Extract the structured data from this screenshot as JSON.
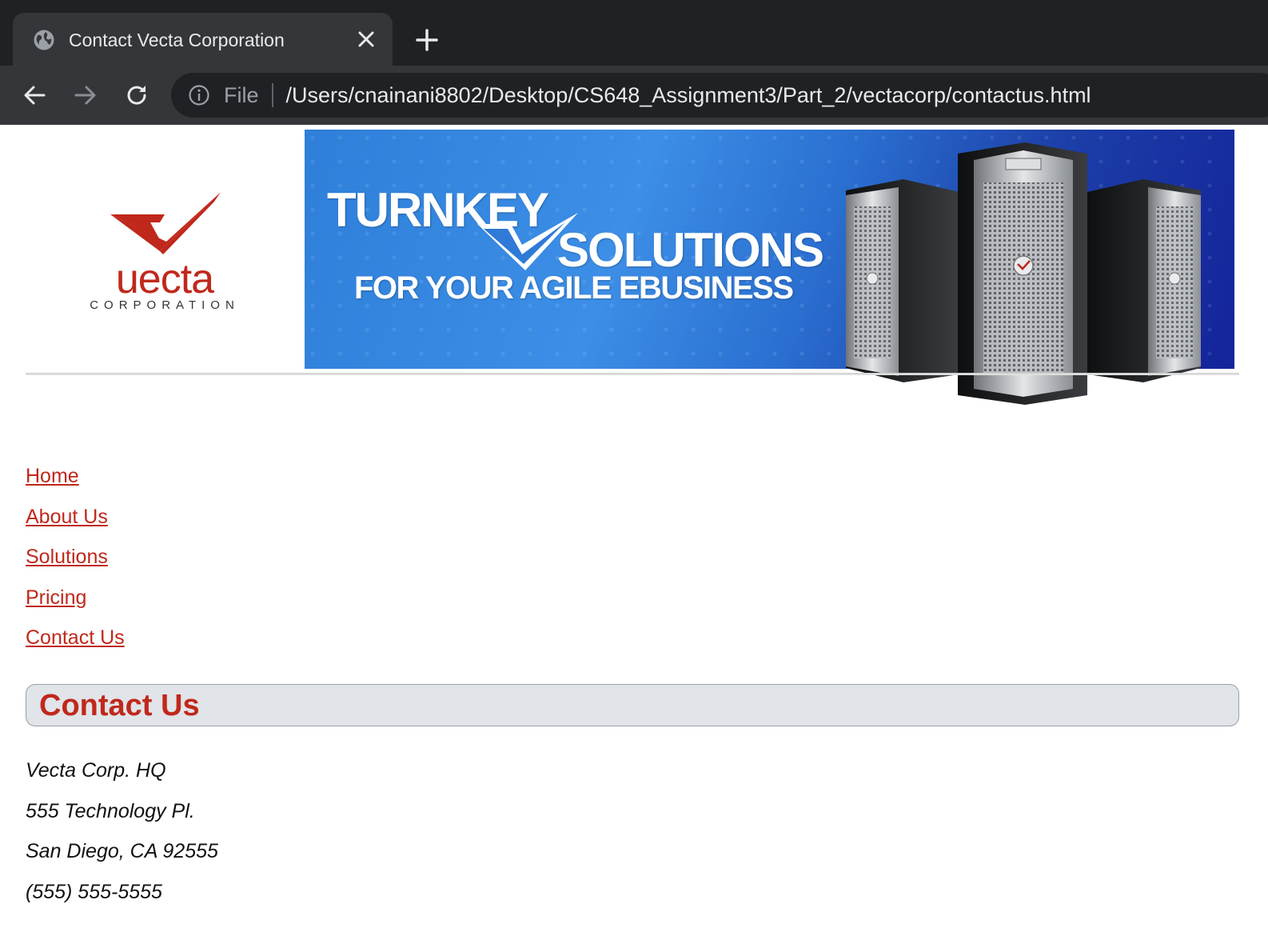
{
  "browser": {
    "tab": {
      "title": "Contact Vecta Corporation",
      "icon": "globe-icon",
      "close_icon": "close-icon"
    },
    "new_tab_icon": "plus-icon",
    "toolbar": {
      "back_icon": "arrow-left-icon",
      "forward_icon": "arrow-right-icon",
      "reload_icon": "reload-icon",
      "info_icon": "info-icon",
      "scheme_label": "File",
      "url": "/Users/cnainani8802/Desktop/CS648_Assignment3/Part_2/vectacorp/contactus.html"
    }
  },
  "header": {
    "logo": {
      "wordmark": "uecta",
      "subtitle": "CORPORATION"
    },
    "banner": {
      "line1": "TURNKEY",
      "line2": "SOLUTIONS",
      "line3": "FOR YOUR AGILE EBUSINESS"
    }
  },
  "nav": {
    "items": [
      {
        "label": "Home"
      },
      {
        "label": "About Us"
      },
      {
        "label": "Solutions"
      },
      {
        "label": "Pricing"
      },
      {
        "label": "Contact Us"
      }
    ]
  },
  "main": {
    "heading": "Contact Us",
    "address": {
      "company": "Vecta Corp. HQ",
      "street": "555 Technology Pl.",
      "city": "San Diego, CA 92555",
      "phone": "(555) 555-5555"
    }
  },
  "colors": {
    "brand_red": "#c0281c",
    "chrome_dark": "#202124",
    "chrome_tab": "#35363a",
    "section_bar": "#e1e4e8",
    "banner_blue": "#2e7fd9"
  }
}
